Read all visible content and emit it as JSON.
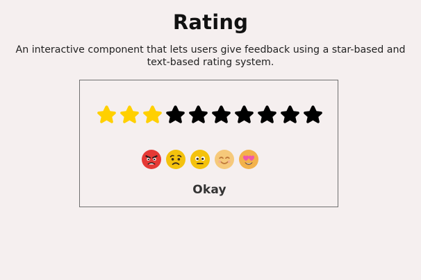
{
  "header": {
    "title": "Rating",
    "subtitle_line1": "An interactive component that lets users give feedback using a star-based and",
    "subtitle_line2": "text-based rating system."
  },
  "rating": {
    "max_stars": 10,
    "selected_stars": 3,
    "filled_color": "#ffd000",
    "empty_color": "#000000",
    "label": "Okay"
  },
  "emojis": [
    {
      "name": "angry-face-icon",
      "color": "#e53935"
    },
    {
      "name": "sad-face-icon",
      "color": "#f4c20d"
    },
    {
      "name": "neutral-face-icon",
      "color": "#f4c20d"
    },
    {
      "name": "smiling-face-icon",
      "color": "#f6c97a"
    },
    {
      "name": "heart-eyes-face-icon",
      "color": "#f3b24b"
    }
  ]
}
